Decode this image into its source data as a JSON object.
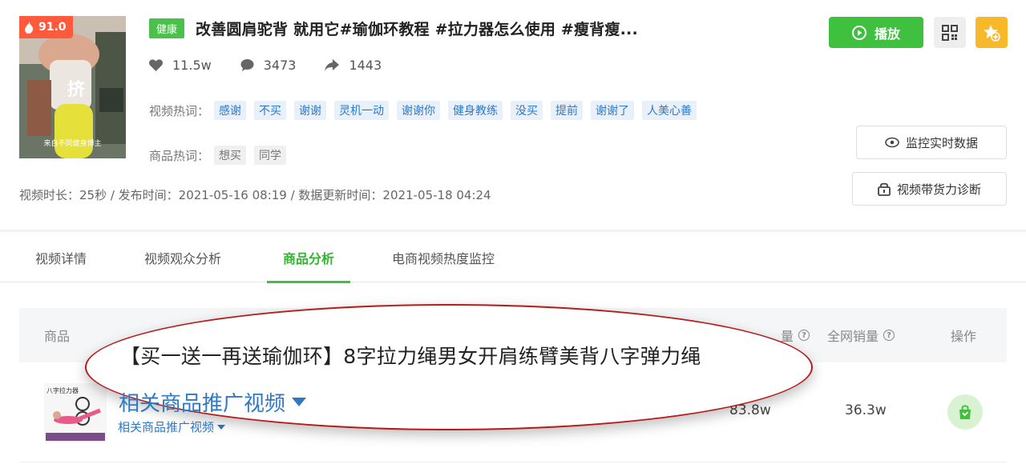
{
  "video": {
    "score": "91.0",
    "thumb_text": "挤",
    "thumb_caption": "来自不同健身博主",
    "category": "健康",
    "title": "改善圆肩驼背 就用它#瑜伽环教程 #拉力器怎么使用 #瘦背瘦...",
    "likes": "11.5w",
    "comments": "3473",
    "shares": "1443",
    "hot_words_label": "视频热词：",
    "hot_words": [
      "感谢",
      "不买",
      "谢谢",
      "灵机一动",
      "谢谢你",
      "健身教练",
      "没买",
      "提前",
      "谢谢了",
      "人美心善"
    ],
    "product_words_label": "商品热词：",
    "product_words": [
      "想买",
      "同学"
    ],
    "meta": "视频时长：25秒 / 发布时间：2021-05-16 08:19 / 数据更新时间：2021-05-18 04:24"
  },
  "actions": {
    "play_label": "播放",
    "monitor_label": "监控实时数据",
    "diagnose_label": "视频带货力诊断"
  },
  "tabs": [
    "视频详情",
    "视频观众分析",
    "商品分析",
    "电商视频热度监控"
  ],
  "active_tab": "商品分析",
  "table": {
    "headers": {
      "product": "商品",
      "sales_suffix": "量",
      "total_sales": "全网销量",
      "actions": "操作"
    },
    "row": {
      "image_label": "八字拉力器",
      "product_title": "【买一送一再送瑜伽环】8字拉力绳男女开肩练臂美背八字弹力绳",
      "related_link": "相关商品推广视频",
      "related_link_zoom": "相关商品推广视频",
      "sales": "83.8w",
      "total_sales": "36.3w"
    }
  },
  "colors": {
    "brand_green": "#3fc13f",
    "link_blue": "#2f78c4",
    "score_red": "#ff5a3c",
    "star_yellow": "#f7b829",
    "ellipse_red": "#b81b1b"
  }
}
